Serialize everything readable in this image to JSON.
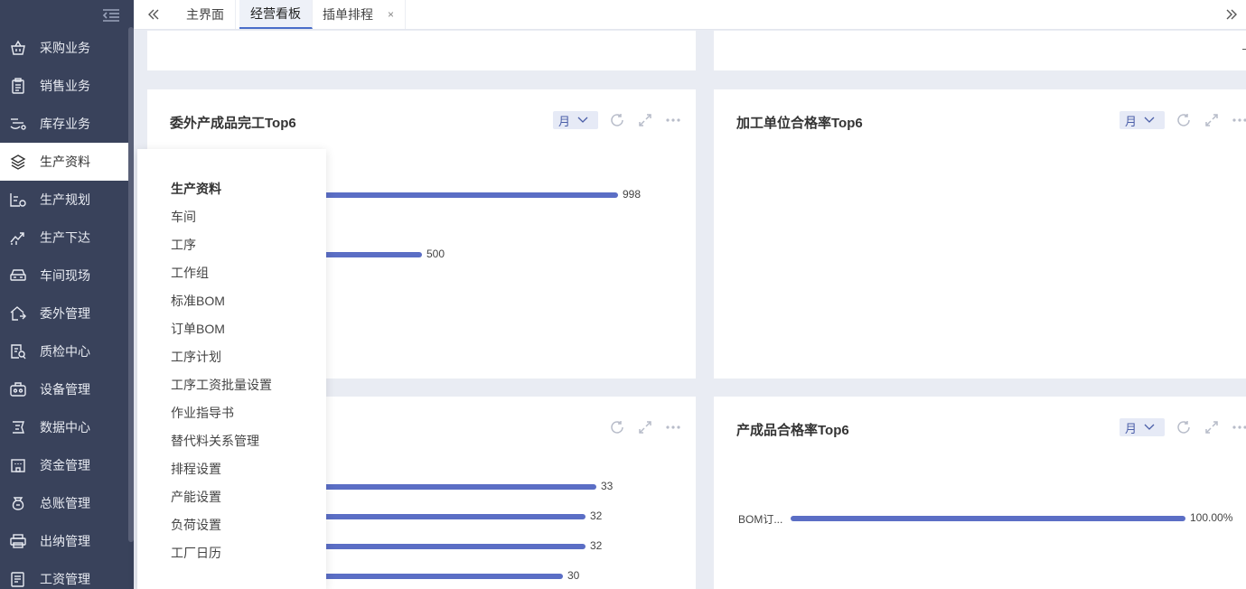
{
  "sidebar": {
    "items": [
      {
        "label": "采购业务",
        "icon": "basket-icon"
      },
      {
        "label": "销售业务",
        "icon": "clipboard-icon"
      },
      {
        "label": "库存业务",
        "icon": "inventory-icon"
      },
      {
        "label": "生产资料",
        "icon": "layers-icon",
        "active": true
      },
      {
        "label": "生产规划",
        "icon": "plan-icon"
      },
      {
        "label": "生产下达",
        "icon": "trend-icon"
      },
      {
        "label": "车间现场",
        "icon": "workshop-icon"
      },
      {
        "label": "委外管理",
        "icon": "outsource-icon"
      },
      {
        "label": "质检中心",
        "icon": "inspection-icon"
      },
      {
        "label": "设备管理",
        "icon": "equipment-icon"
      },
      {
        "label": "数据中心",
        "icon": "data-icon"
      },
      {
        "label": "资金管理",
        "icon": "building-icon"
      },
      {
        "label": "总账管理",
        "icon": "ledger-icon"
      },
      {
        "label": "出纳管理",
        "icon": "printer-icon"
      },
      {
        "label": "工资管理",
        "icon": "salary-icon"
      }
    ]
  },
  "tabs": {
    "items": [
      {
        "label": "主界面"
      },
      {
        "label": "经营看板",
        "active": true
      },
      {
        "label": "插单排程",
        "closable": true
      }
    ],
    "close_glyph": "×"
  },
  "flyout": {
    "title": "生产资料",
    "items": [
      "车间",
      "工序",
      "工作组",
      "标准BOM",
      "订单BOM",
      "工序计划",
      "工序工资批量设置",
      "作业指导书",
      "替代料关系管理",
      "排程设置",
      "产能设置",
      "负荷设置",
      "工厂日历"
    ]
  },
  "cards": {
    "outsourced_completion": {
      "title": "委外产成品完工Top6",
      "period": "月",
      "bars": [
        {
          "value": "998"
        },
        {
          "value": "500"
        }
      ]
    },
    "processing_unit_pass_rate": {
      "title": "加工单位合格率Top6",
      "period": "月"
    },
    "bottom_left": {
      "bars": [
        {
          "value": "33"
        },
        {
          "value": "32"
        },
        {
          "value": "32"
        },
        {
          "value": "30"
        }
      ]
    },
    "finished_product_pass_rate": {
      "title": "产成品合格率Top6",
      "period": "月",
      "bars": [
        {
          "label": "BOM订...",
          "value": "100.00%"
        }
      ]
    }
  },
  "colors": {
    "sidebar_bg": "#39425b",
    "bar": "#5b6ec5",
    "accent": "#4a6dc9"
  }
}
